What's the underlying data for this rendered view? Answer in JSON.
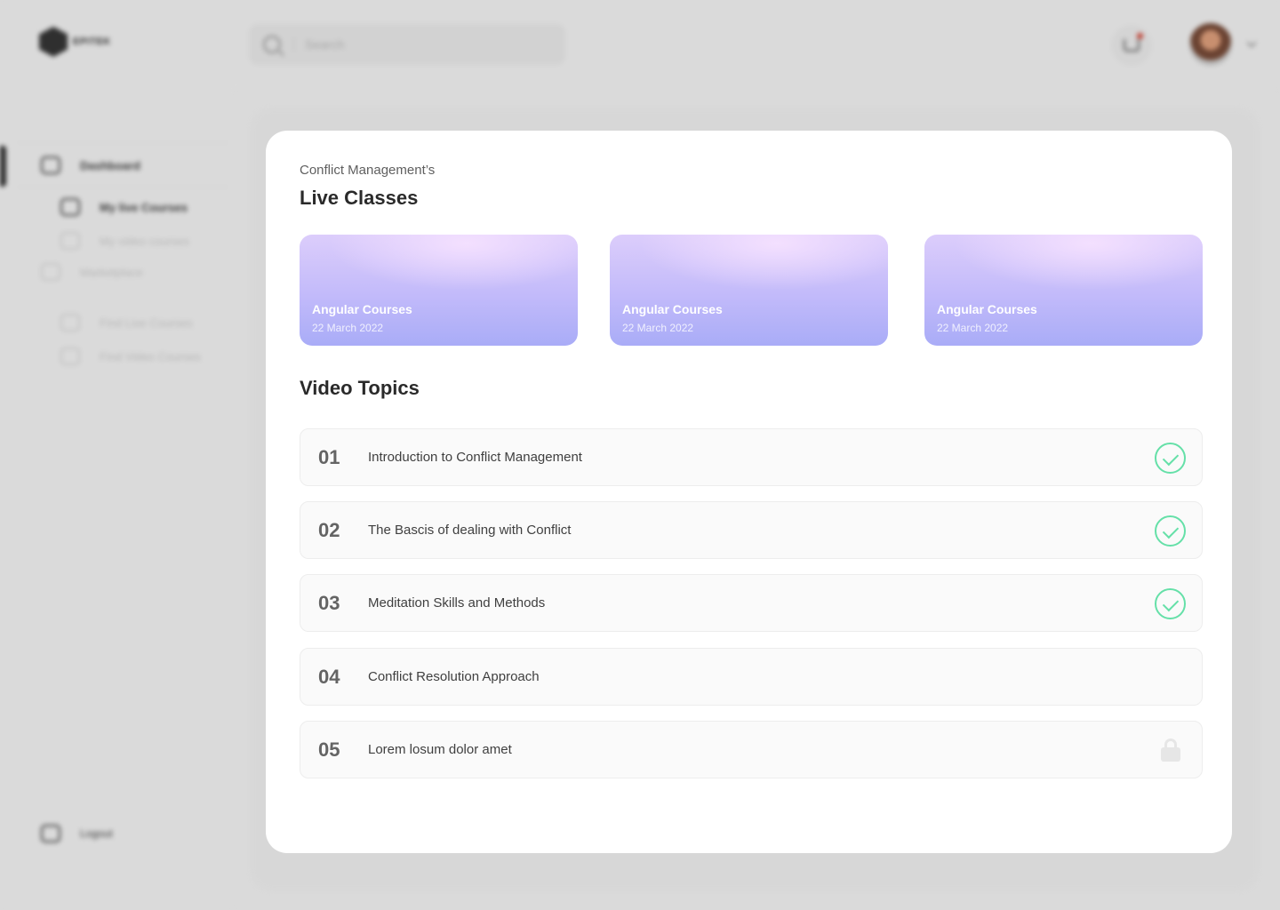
{
  "app": {
    "brand": "EPITEK"
  },
  "search": {
    "placeholder": "Search"
  },
  "sidebar": {
    "items": [
      {
        "label": "Dashboard",
        "icon": "dashboard-icon"
      },
      {
        "label": "My live Courses",
        "icon": "live-courses-icon"
      },
      {
        "label": "My video courses",
        "icon": "video-courses-icon"
      },
      {
        "label": "Marketplace",
        "icon": "marketplace-icon"
      },
      {
        "label": "Find Live Courses",
        "icon": "find-live-icon"
      },
      {
        "label": "Find Video Courses",
        "icon": "find-video-icon"
      }
    ],
    "logout": "Logout"
  },
  "modal": {
    "subtitle": "Conflict Management’s",
    "live_title": "Live Classes",
    "video_title": "Video Topics",
    "live_classes": [
      {
        "title": "Angular Courses",
        "date": "22 March 2022"
      },
      {
        "title": "Angular Courses",
        "date": "22 March 2022"
      },
      {
        "title": "Angular Courses",
        "date": "22 March 2022"
      }
    ],
    "topics": [
      {
        "num": "01",
        "title": "Introduction to Conflict Management",
        "status": "completed"
      },
      {
        "num": "02",
        "title": "The Bascis  of dealing with Conflict",
        "status": "completed"
      },
      {
        "num": "03",
        "title": "Meditation Skills and Methods",
        "status": "completed"
      },
      {
        "num": "04",
        "title": "Conflict Resolution Approach",
        "status": "none"
      },
      {
        "num": "05",
        "title": "Lorem losum dolor amet",
        "status": "locked"
      }
    ]
  },
  "colors": {
    "check": "#65e0a8",
    "card_gradient_top": "#dccdfb",
    "card_gradient_bottom": "#a9acf7"
  }
}
